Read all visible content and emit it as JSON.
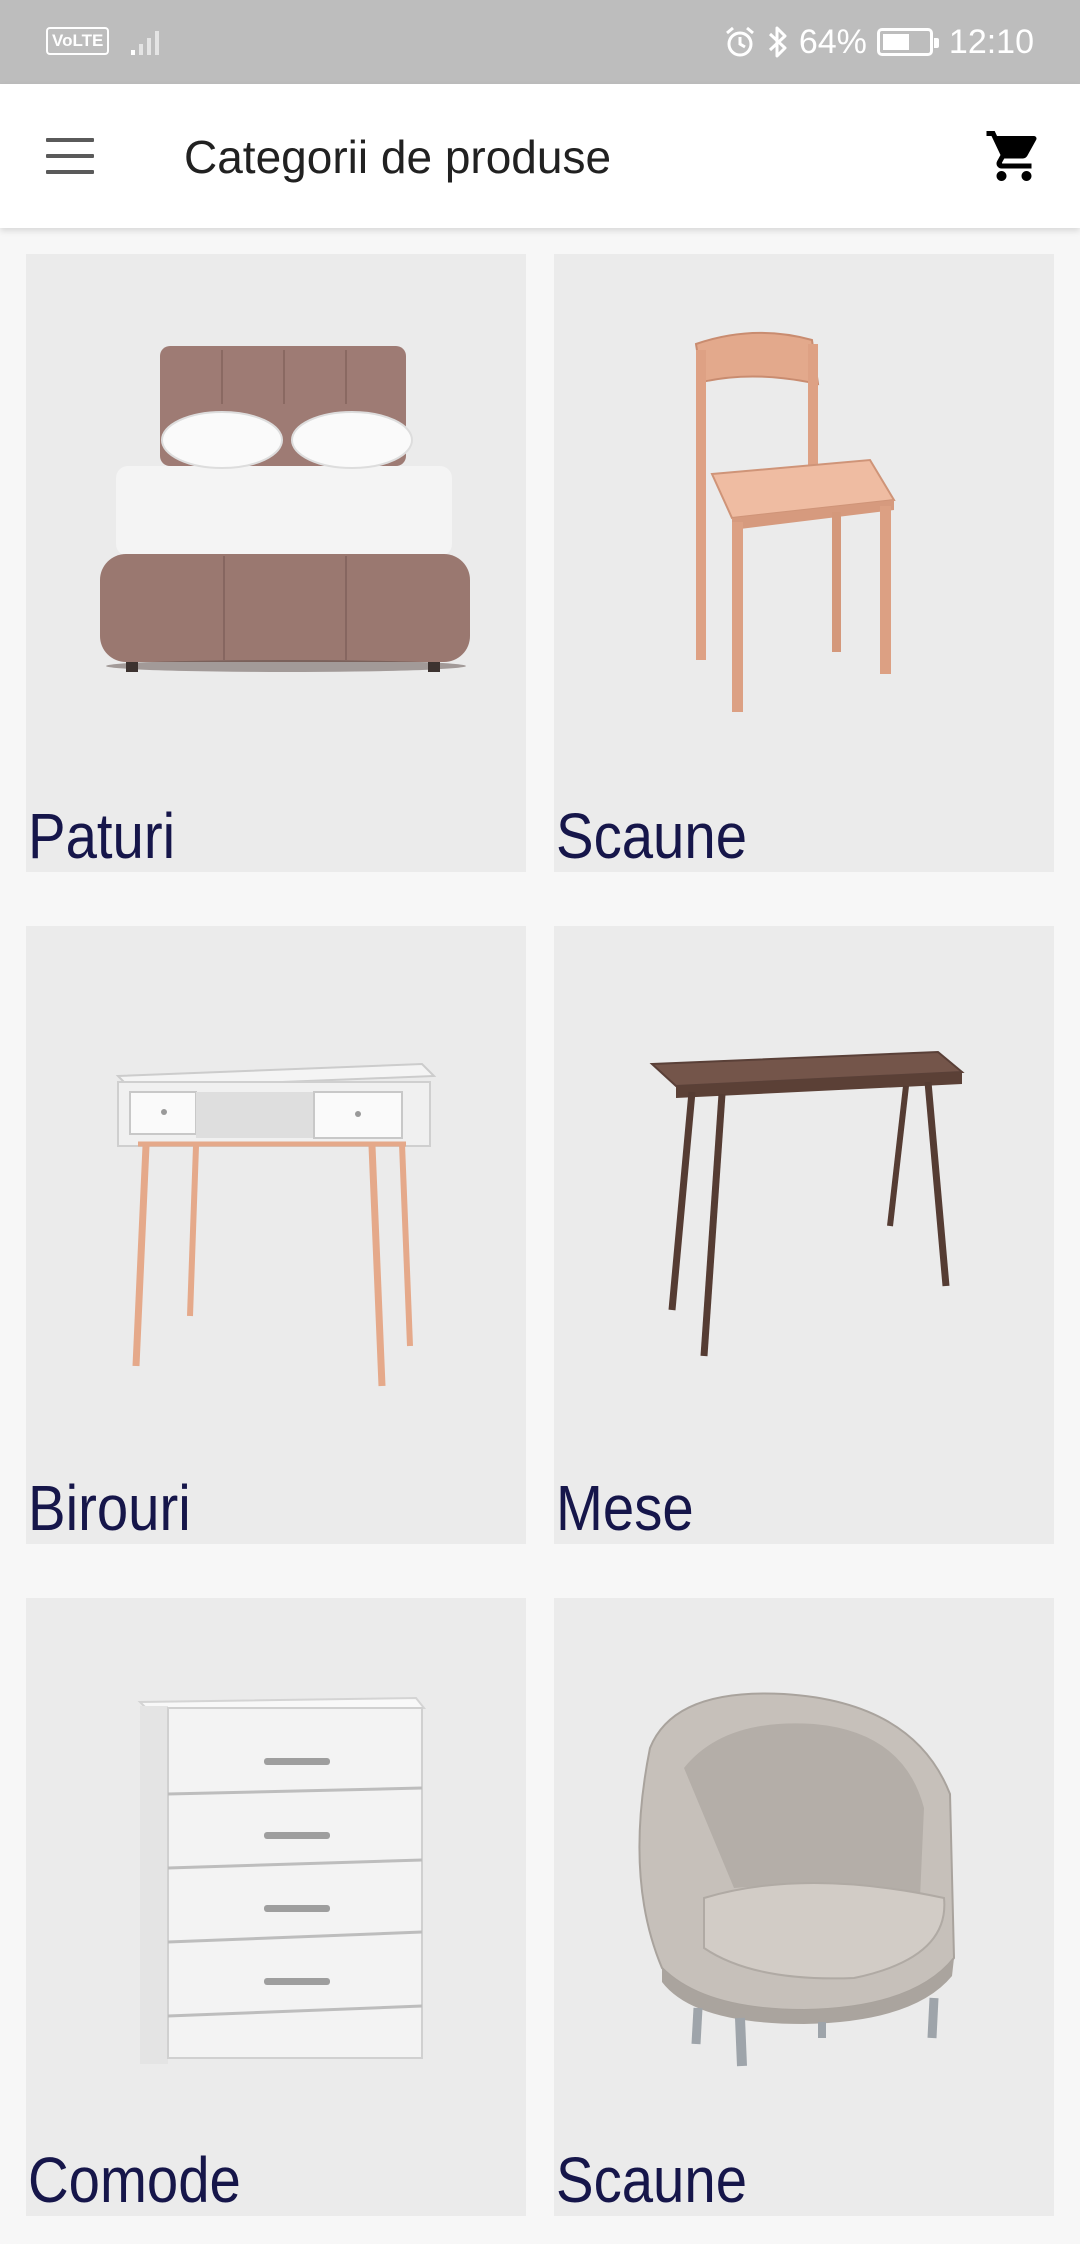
{
  "status_bar": {
    "network_badge": "VoLTE",
    "signal_icon": "signal-icon",
    "alarm_icon": "alarm-icon",
    "bluetooth_icon": "bluetooth-icon",
    "battery_percent": "64%",
    "battery_level": 0.64,
    "time": "12:10"
  },
  "app_bar": {
    "title": "Categorii de produse",
    "menu_icon": "hamburger-menu-icon",
    "cart_icon": "shopping-cart-icon"
  },
  "categories": [
    {
      "label": "Paturi",
      "image": "bed-image"
    },
    {
      "label": "Scaune",
      "image": "wooden-chair-image"
    },
    {
      "label": "Birouri",
      "image": "desk-image"
    },
    {
      "label": "Mese",
      "image": "table-image"
    },
    {
      "label": "Comode",
      "image": "chest-of-drawers-image"
    },
    {
      "label": "Scaune",
      "image": "armchair-image"
    }
  ],
  "colors": {
    "status_bar": "#bdbdbd",
    "app_bar": "#ffffff",
    "card_bg": "#ebebeb",
    "label_text": "#16164a",
    "page_bg": "#f7f7f7"
  }
}
